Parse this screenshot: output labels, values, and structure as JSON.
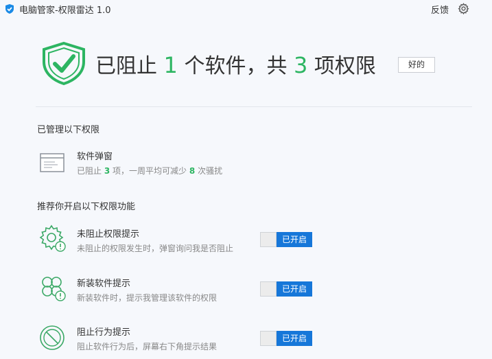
{
  "window": {
    "title": "电脑管家-权限雷达 1.0",
    "feedback": "反馈",
    "settings_icon": "gear-icon"
  },
  "summary": {
    "prefix": "已阻止",
    "software_count": "1",
    "middle": "个软件，共",
    "permission_count": "3",
    "suffix": "项权限",
    "ok_button": "好的"
  },
  "managed": {
    "title": "已管理以下权限",
    "items": [
      {
        "name": "软件弹窗",
        "desc_prefix": "已阻止",
        "blocked": "3",
        "desc_mid": "项，一周平均可减少",
        "reduced": "8",
        "desc_suffix": "次骚扰",
        "icon": "window-icon"
      }
    ]
  },
  "recommend": {
    "title": "推荐你开启以下权限功能",
    "items": [
      {
        "name": "未阻止权限提示",
        "desc": "未阻止的权限发生时，弹窗询问我是否阻止",
        "toggle": "已开启",
        "icon": "gear-alert-icon"
      },
      {
        "name": "新装软件提示",
        "desc": "新装软件时，提示我管理该软件的权限",
        "toggle": "已开启",
        "icon": "clover-alert-icon"
      },
      {
        "name": "阻止行为提示",
        "desc": "阻止软件行为后，屏幕右下角提示结果",
        "toggle": "已开启",
        "icon": "block-icon"
      }
    ]
  },
  "colors": {
    "accent_green": "#2db562",
    "toggle_blue": "#1677d9",
    "icon_green": "#3aa865"
  }
}
